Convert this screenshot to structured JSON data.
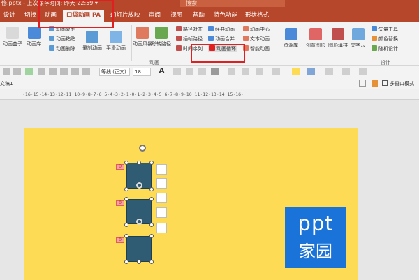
{
  "titlebar": {
    "file_title": "修.pptx - 上次保存时间: 昨天 22:59 ▾",
    "search_placeholder": "搜索"
  },
  "tabs": [
    "设计",
    "切换",
    "动画",
    "口袋动画 PA",
    "幻灯片放映",
    "审阅",
    "视图",
    "帮助",
    "特色功能",
    "形状格式"
  ],
  "ribbon": {
    "large_buttons": [
      "动画盒子",
      "动画库",
      "录制动画",
      "平滑动画",
      "动画风暴",
      "形转路径",
      "资源库",
      "创意图形",
      "图形填排",
      "文字云"
    ],
    "small_rows": {
      "col1": [
        "动画复制",
        "动画粘贴",
        "动画删除"
      ],
      "col2": [
        "路径对齐",
        "插帧路径",
        "时间序列"
      ],
      "col3": [
        "经典动画",
        "动画合并",
        "动画循环"
      ],
      "col4": [
        "动画中心",
        "文本动画",
        "智能动画"
      ],
      "col5": [
        "矢量工具",
        "颜色替换",
        "随机设计"
      ]
    },
    "groups": {
      "anim": "动画",
      "design": "设计"
    }
  },
  "format_bar": {
    "font": "等线 (正文)",
    "size": "18"
  },
  "pane": {
    "label": "文稿1",
    "right_label": "多窗口模式"
  },
  "ruler_text": "·16·15·14·13·12·11·10·9·8·7·6·5·4·3·2·1·0·1·2·3·4·5·6·7·8·9·10·11·12·13·14·15·16·",
  "slide": {
    "badges": [
      "0",
      "0",
      "0"
    ],
    "logo_top": "ppt",
    "logo_bottom": "家园"
  },
  "colors": {
    "accent": "#b7472a",
    "slide_bg": "#fddb55",
    "shape": "#2f5b73",
    "logo": "#1a73d8",
    "highlight": "#e02020"
  }
}
